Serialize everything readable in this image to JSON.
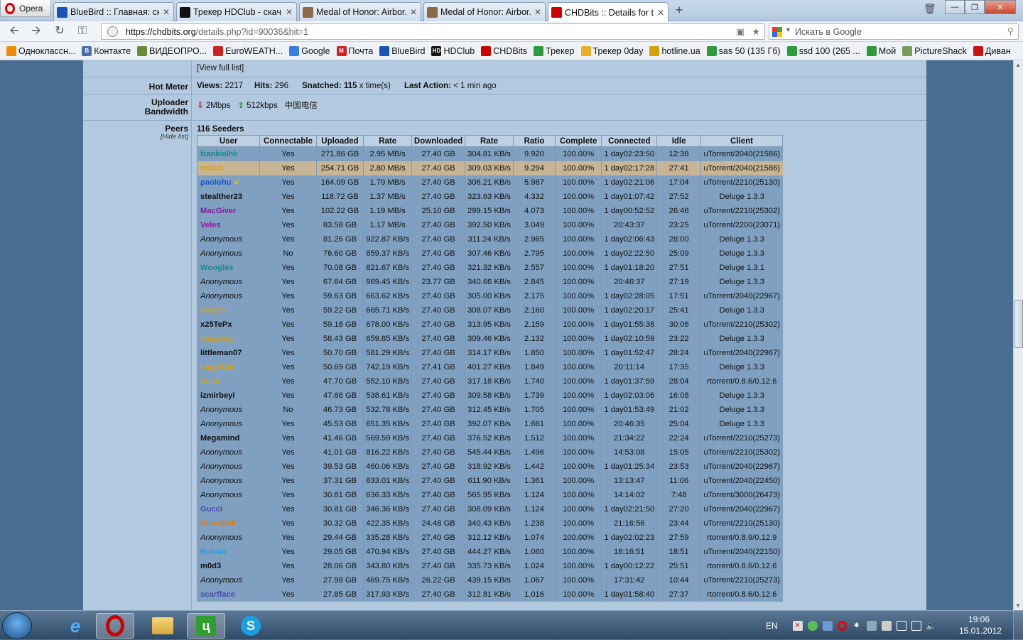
{
  "browser": {
    "menu_label": "Opera",
    "tabs": [
      {
        "label": "BlueBird :: Главная: ск...",
        "icon": "bluebird-icon",
        "icon_color": "#1a55b5"
      },
      {
        "label": "Трекер HDClub - скач...",
        "icon": "hdclub-icon",
        "icon_color": "#111111"
      },
      {
        "label": "Medal of Honor: Airbor...",
        "icon": "page-icon",
        "icon_color": "#8a6a4a"
      },
      {
        "label": "Medal of Honor: Airbor...",
        "icon": "page-icon",
        "icon_color": "#8a6a4a"
      },
      {
        "label": "CHDBits :: Details for to...",
        "icon": "chdbits-icon",
        "icon_color": "#cc0000"
      }
    ],
    "url_host": "https://chdbits.org",
    "url_path": "/details.php?id=90036&hit=1",
    "search_placeholder": "Искать в Google",
    "bookmarks": [
      {
        "label": "Одноклассн...",
        "icon_color": "#f08a00"
      },
      {
        "label": "Контакте",
        "icon_color": "#4a6ea8",
        "glyph": "B"
      },
      {
        "label": "ВИДЕОПРО...",
        "icon_color": "#6a8a3a"
      },
      {
        "label": "EuroWEATH...",
        "icon_color": "#d02020"
      },
      {
        "label": "Google",
        "icon_color": "#3a7de0"
      },
      {
        "label": "Почта",
        "icon_color": "#d02020",
        "glyph": "M"
      },
      {
        "label": "BlueBird",
        "icon_color": "#1a55b5"
      },
      {
        "label": "HDClub",
        "icon_color": "#111111",
        "glyph": "HD"
      },
      {
        "label": "CHDBits",
        "icon_color": "#cc0000"
      },
      {
        "label": "Трекер",
        "icon_color": "#2a9a3a"
      },
      {
        "label": "Трекер 0day",
        "icon_color": "#e8b020"
      },
      {
        "label": "hotline.ua",
        "icon_color": "#d8a000"
      },
      {
        "label": "sas 50 (135 Гб)",
        "icon_color": "#2a9a3a"
      },
      {
        "label": "ssd 100 (265 ...",
        "icon_color": "#2a9a3a"
      },
      {
        "label": "Мой",
        "icon_color": "#2a9a3a"
      },
      {
        "label": "PictureShack",
        "icon_color": "#7a9a5a"
      },
      {
        "label": "Диван",
        "icon_color": "#cc1111"
      }
    ]
  },
  "torrent_info": {
    "view_full_list": "[View full list]"
  },
  "hot_meter": {
    "label": "Hot Meter",
    "views_label": "Views:",
    "views": "2217",
    "hits_label": "Hits:",
    "hits": "296",
    "snatched_label": "Snatched:",
    "snatched": "115",
    "snatched_suffix": "x time(s)",
    "last_action_label": "Last Action:",
    "last_action": "< 1 min ago"
  },
  "uploader_bandwidth": {
    "label_line1": "Uploader",
    "label_line2": "Bandwidth",
    "down": "2Mbps",
    "up": "512kbps",
    "isp": "中国电信"
  },
  "peers": {
    "label": "Peers",
    "hide_list": "[Hide list]",
    "seeders_title": "116 Seeders",
    "columns": [
      "User",
      "Connectable",
      "Uploaded",
      "Rate",
      "Downloaded",
      "Rate",
      "Ratio",
      "Complete",
      "Connected",
      "Idle",
      "Client"
    ],
    "rows": [
      {
        "user": "frankielhk",
        "color": "#1a8a8a",
        "conn": "Yes",
        "up": "271.86 GB",
        "urate": "2.95 MB/s",
        "down": "27.40 GB",
        "drate": "304.81 KB/s",
        "ratio": "9.920",
        "complete": "100.00%",
        "connected": "1 day02:23:50",
        "idle": "12:38",
        "client": "uTorrent/2040(21586)"
      },
      {
        "user": "mokis",
        "color": "#d4a21a",
        "conn": "Yes",
        "up": "254.71 GB",
        "urate": "2.80 MB/s",
        "down": "27.40 GB",
        "drate": "309.03 KB/s",
        "ratio": "9.294",
        "complete": "100.00%",
        "connected": "1 day02:17:28",
        "idle": "27:41",
        "client": "uTorrent/2040(21586)",
        "highlight": true
      },
      {
        "user": "paolohu",
        "color": "#1a55d0",
        "star": true,
        "conn": "Yes",
        "up": "164.09 GB",
        "urate": "1.79 MB/s",
        "down": "27.40 GB",
        "drate": "306.21 KB/s",
        "ratio": "5.987",
        "complete": "100.00%",
        "connected": "1 day02:21:06",
        "idle": "17:04",
        "client": "uTorrent/2210(25130)"
      },
      {
        "user": "stealther23",
        "color": "#111111",
        "conn": "Yes",
        "up": "118.72 GB",
        "urate": "1.37 MB/s",
        "down": "27.40 GB",
        "drate": "323.63 KB/s",
        "ratio": "4.332",
        "complete": "100.00%",
        "connected": "1 day01:07:42",
        "idle": "27:52",
        "client": "Deluge 1.3.3"
      },
      {
        "user": "MacGiver",
        "color": "#8a1a9a",
        "conn": "Yes",
        "up": "102.22 GB",
        "urate": "1.19 MB/s",
        "down": "25.10 GB",
        "drate": "299.15 KB/s",
        "ratio": "4.073",
        "complete": "100.00%",
        "connected": "1 day00:52:52",
        "idle": "26:46",
        "client": "uTorrent/2210(25302)"
      },
      {
        "user": "Veles",
        "color": "#8a1a9a",
        "conn": "Yes",
        "up": "83.58 GB",
        "urate": "1.17 MB/s",
        "down": "27.40 GB",
        "drate": "392.50 KB/s",
        "ratio": "3.049",
        "complete": "100.00%",
        "connected": "20:43:37",
        "idle": "23:25",
        "client": "uTorrent/2200(23071)"
      },
      {
        "user": "Anonymous",
        "anon": true,
        "conn": "Yes",
        "up": "81.26 GB",
        "urate": "922.87 KB/s",
        "down": "27.40 GB",
        "drate": "311.24 KB/s",
        "ratio": "2.965",
        "complete": "100.00%",
        "connected": "1 day02:06:43",
        "idle": "28:00",
        "client": "Deluge 1.3.3"
      },
      {
        "user": "Anonymous",
        "anon": true,
        "conn": "No",
        "up": "76.60 GB",
        "urate": "859.37 KB/s",
        "down": "27.40 GB",
        "drate": "307.46 KB/s",
        "ratio": "2.795",
        "complete": "100.00%",
        "connected": "1 day02:22:50",
        "idle": "25:09",
        "client": "Deluge 1.3.3"
      },
      {
        "user": "Woogles",
        "color": "#1a8a8a",
        "conn": "Yes",
        "up": "70.08 GB",
        "urate": "821.67 KB/s",
        "down": "27.40 GB",
        "drate": "321.32 KB/s",
        "ratio": "2.557",
        "complete": "100.00%",
        "connected": "1 day01:18:20",
        "idle": "27:51",
        "client": "Deluge 1.3.1"
      },
      {
        "user": "Anonymous",
        "anon": true,
        "conn": "Yes",
        "up": "67.64 GB",
        "urate": "969.45 KB/s",
        "down": "23.77 GB",
        "drate": "340.66 KB/s",
        "ratio": "2.845",
        "complete": "100.00%",
        "connected": "20:46:37",
        "idle": "27:19",
        "client": "Deluge 1.3.3"
      },
      {
        "user": "Anonymous",
        "anon": true,
        "conn": "Yes",
        "up": "59.63 GB",
        "urate": "663.62 KB/s",
        "down": "27.40 GB",
        "drate": "305.00 KB/s",
        "ratio": "2.175",
        "complete": "100.00%",
        "connected": "1 day02:28:05",
        "idle": "17:51",
        "client": "uTorrent/2040(22967)"
      },
      {
        "user": "kros77",
        "color": "#d4a21a",
        "conn": "Yes",
        "up": "59.22 GB",
        "urate": "665.71 KB/s",
        "down": "27.40 GB",
        "drate": "308.07 KB/s",
        "ratio": "2.160",
        "complete": "100.00%",
        "connected": "1 day02:20:17",
        "idle": "25:41",
        "client": "Deluge 1.3.3"
      },
      {
        "user": "x25TePx",
        "color": "#111111",
        "conn": "Yes",
        "up": "59.18 GB",
        "urate": "678.00 KB/s",
        "down": "27.40 GB",
        "drate": "313.95 KB/s",
        "ratio": "2.159",
        "complete": "100.00%",
        "connected": "1 day01:55:38",
        "idle": "30:06",
        "client": "uTorrent/2210(25302)"
      },
      {
        "user": "kingzerg",
        "color": "#d4a21a",
        "conn": "Yes",
        "up": "58.43 GB",
        "urate": "659.85 KB/s",
        "down": "27.40 GB",
        "drate": "309.46 KB/s",
        "ratio": "2.132",
        "complete": "100.00%",
        "connected": "1 day02:10:59",
        "idle": "23:22",
        "client": "Deluge 1.3.3"
      },
      {
        "user": "littleman07",
        "color": "#111111",
        "conn": "Yes",
        "up": "50.70 GB",
        "urate": "581.29 KB/s",
        "down": "27.40 GB",
        "drate": "314.17 KB/s",
        "ratio": "1.850",
        "complete": "100.00%",
        "connected": "1 day01:52:47",
        "idle": "28:24",
        "client": "uTorrent/2040(22967)"
      },
      {
        "user": "LegoCab",
        "color": "#d4a21a",
        "conn": "Yes",
        "up": "50.69 GB",
        "urate": "742.19 KB/s",
        "down": "27.41 GB",
        "drate": "401.27 KB/s",
        "ratio": "1.849",
        "complete": "100.00%",
        "connected": "20:11:14",
        "idle": "17:35",
        "client": "Deluge 1.3.3"
      },
      {
        "user": "Nella",
        "color": "#d4a21a",
        "conn": "Yes",
        "up": "47.70 GB",
        "urate": "552.10 KB/s",
        "down": "27.40 GB",
        "drate": "317.18 KB/s",
        "ratio": "1.740",
        "complete": "100.00%",
        "connected": "1 day01:37:59",
        "idle": "28:04",
        "client": "rtorrent/0.8.6/0.12.6"
      },
      {
        "user": "izmirbeyi",
        "color": "#111111",
        "conn": "Yes",
        "up": "47.68 GB",
        "urate": "538.61 KB/s",
        "down": "27.40 GB",
        "drate": "309.58 KB/s",
        "ratio": "1.739",
        "complete": "100.00%",
        "connected": "1 day02:03:06",
        "idle": "16:08",
        "client": "Deluge 1.3.3"
      },
      {
        "user": "Anonymous",
        "anon": true,
        "conn": "No",
        "up": "46.73 GB",
        "urate": "532.78 KB/s",
        "down": "27.40 GB",
        "drate": "312.45 KB/s",
        "ratio": "1.705",
        "complete": "100.00%",
        "connected": "1 day01:53:49",
        "idle": "21:02",
        "client": "Deluge 1.3.3"
      },
      {
        "user": "Anonymous",
        "anon": true,
        "conn": "Yes",
        "up": "45.53 GB",
        "urate": "651.35 KB/s",
        "down": "27.40 GB",
        "drate": "392.07 KB/s",
        "ratio": "1.661",
        "complete": "100.00%",
        "connected": "20:46:35",
        "idle": "25:04",
        "client": "Deluge 1.3.3"
      },
      {
        "user": "Megamind",
        "color": "#111111",
        "conn": "Yes",
        "up": "41.46 GB",
        "urate": "569.59 KB/s",
        "down": "27.40 GB",
        "drate": "376.52 KB/s",
        "ratio": "1.512",
        "complete": "100.00%",
        "connected": "21:34:22",
        "idle": "22:24",
        "client": "uTorrent/2210(25273)"
      },
      {
        "user": "Anonymous",
        "anon": true,
        "conn": "Yes",
        "up": "41.01 GB",
        "urate": "816.22 KB/s",
        "down": "27.40 GB",
        "drate": "545.44 KB/s",
        "ratio": "1.496",
        "complete": "100.00%",
        "connected": "14:53:08",
        "idle": "15:05",
        "client": "uTorrent/2210(25302)"
      },
      {
        "user": "Anonymous",
        "anon": true,
        "conn": "Yes",
        "up": "39.53 GB",
        "urate": "460.06 KB/s",
        "down": "27.40 GB",
        "drate": "318.92 KB/s",
        "ratio": "1.442",
        "complete": "100.00%",
        "connected": "1 day01:25:34",
        "idle": "23:53",
        "client": "uTorrent/2040(22967)"
      },
      {
        "user": "Anonymous",
        "anon": true,
        "conn": "Yes",
        "up": "37.31 GB",
        "urate": "833.01 KB/s",
        "down": "27.40 GB",
        "drate": "611.90 KB/s",
        "ratio": "1.361",
        "complete": "100.00%",
        "connected": "13:13:47",
        "idle": "11:06",
        "client": "uTorrent/2040(22450)"
      },
      {
        "user": "Anonymous",
        "anon": true,
        "conn": "Yes",
        "up": "30.81 GB",
        "urate": "636.33 KB/s",
        "down": "27.40 GB",
        "drate": "565.95 KB/s",
        "ratio": "1.124",
        "complete": "100.00%",
        "connected": "14:14:02",
        "idle": "7:48",
        "client": "uTorrent/3000(26473)"
      },
      {
        "user": "Gucci",
        "color": "#4a4ab0",
        "conn": "Yes",
        "up": "30.81 GB",
        "urate": "346.36 KB/s",
        "down": "27.40 GB",
        "drate": "308.09 KB/s",
        "ratio": "1.124",
        "complete": "100.00%",
        "connected": "1 day02:21:50",
        "idle": "27:20",
        "client": "uTorrent/2040(22967)"
      },
      {
        "user": "Beto4049",
        "color": "#e07a10",
        "conn": "Yes",
        "up": "30.32 GB",
        "urate": "422.35 KB/s",
        "down": "24.48 GB",
        "drate": "340.43 KB/s",
        "ratio": "1.238",
        "complete": "100.00%",
        "connected": "21:16:56",
        "idle": "23:44",
        "client": "uTorrent/2210(25130)"
      },
      {
        "user": "Anonymous",
        "anon": true,
        "conn": "Yes",
        "up": "29.44 GB",
        "urate": "335.28 KB/s",
        "down": "27.40 GB",
        "drate": "312.12 KB/s",
        "ratio": "1.074",
        "complete": "100.00%",
        "connected": "1 day02:02:23",
        "idle": "27:59",
        "client": "rtorrent/0.8.9/0.12.9"
      },
      {
        "user": "Rowan",
        "color": "#2a9ae0",
        "conn": "Yes",
        "up": "29.05 GB",
        "urate": "470.94 KB/s",
        "down": "27.40 GB",
        "drate": "444.27 KB/s",
        "ratio": "1.060",
        "complete": "100.00%",
        "connected": "18:16:51",
        "idle": "18:51",
        "client": "uTorrent/2040(22150)"
      },
      {
        "user": "m0d3",
        "color": "#111111",
        "conn": "Yes",
        "up": "28.06 GB",
        "urate": "343.80 KB/s",
        "down": "27.40 GB",
        "drate": "335.73 KB/s",
        "ratio": "1.024",
        "complete": "100.00%",
        "connected": "1 day00:12:22",
        "idle": "25:51",
        "client": "rtorrent/0.8.6/0.12.6"
      },
      {
        "user": "Anonymous",
        "anon": true,
        "conn": "Yes",
        "up": "27.98 GB",
        "urate": "469.75 KB/s",
        "down": "26.22 GB",
        "drate": "439.15 KB/s",
        "ratio": "1.067",
        "complete": "100.00%",
        "connected": "17:31:42",
        "idle": "10:44",
        "client": "uTorrent/2210(25273)"
      },
      {
        "user": "scarfface",
        "color": "#4a4ab0",
        "conn": "Yes",
        "up": "27.85 GB",
        "urate": "317.93 KB/s",
        "down": "27.40 GB",
        "drate": "312.81 KB/s",
        "ratio": "1.016",
        "complete": "100.00%",
        "connected": "1 day01:58:40",
        "idle": "27:37",
        "client": "rtorrent/0.8.6/0.12.6"
      }
    ]
  },
  "taskbar": {
    "lang": "EN",
    "time": "19:06",
    "date": "15.01.2012"
  }
}
